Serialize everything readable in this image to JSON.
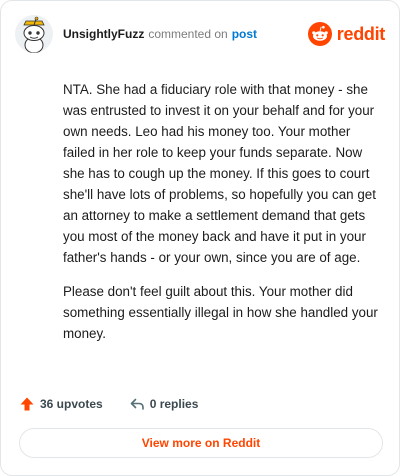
{
  "header": {
    "username": "UnsightlyFuzz",
    "action_text": "commented on",
    "post_link": "post",
    "brand": "reddit"
  },
  "comment": {
    "paragraphs": [
      "NTA. She had a fiduciary role with that money - she was entrusted to invest it on your behalf and for your own needs. Leo had his money too. Your mother failed in her role to keep your funds separate. Now she has to cough up the money. If this goes to court she'll have lots of problems, so hopefully you can get an attorney to make a settlement demand that gets you most of the money back and have it put in your father's hands - or your own, since you are of age.",
      "Please don't feel guilt about this. Your mother did something essentially illegal in how she handled your money."
    ]
  },
  "actions": {
    "upvotes": "36 upvotes",
    "replies": "0 replies"
  },
  "footer": {
    "view_more": "View more on Reddit"
  },
  "colors": {
    "brand": "#ff4500",
    "link": "#0079d3",
    "upvote": "#ff4500"
  },
  "icons": {
    "avatar": "snoo-avatar",
    "brand": "reddit-snoo-icon",
    "upvote": "upvote-arrow-icon",
    "reply": "reply-arrow-icon"
  }
}
